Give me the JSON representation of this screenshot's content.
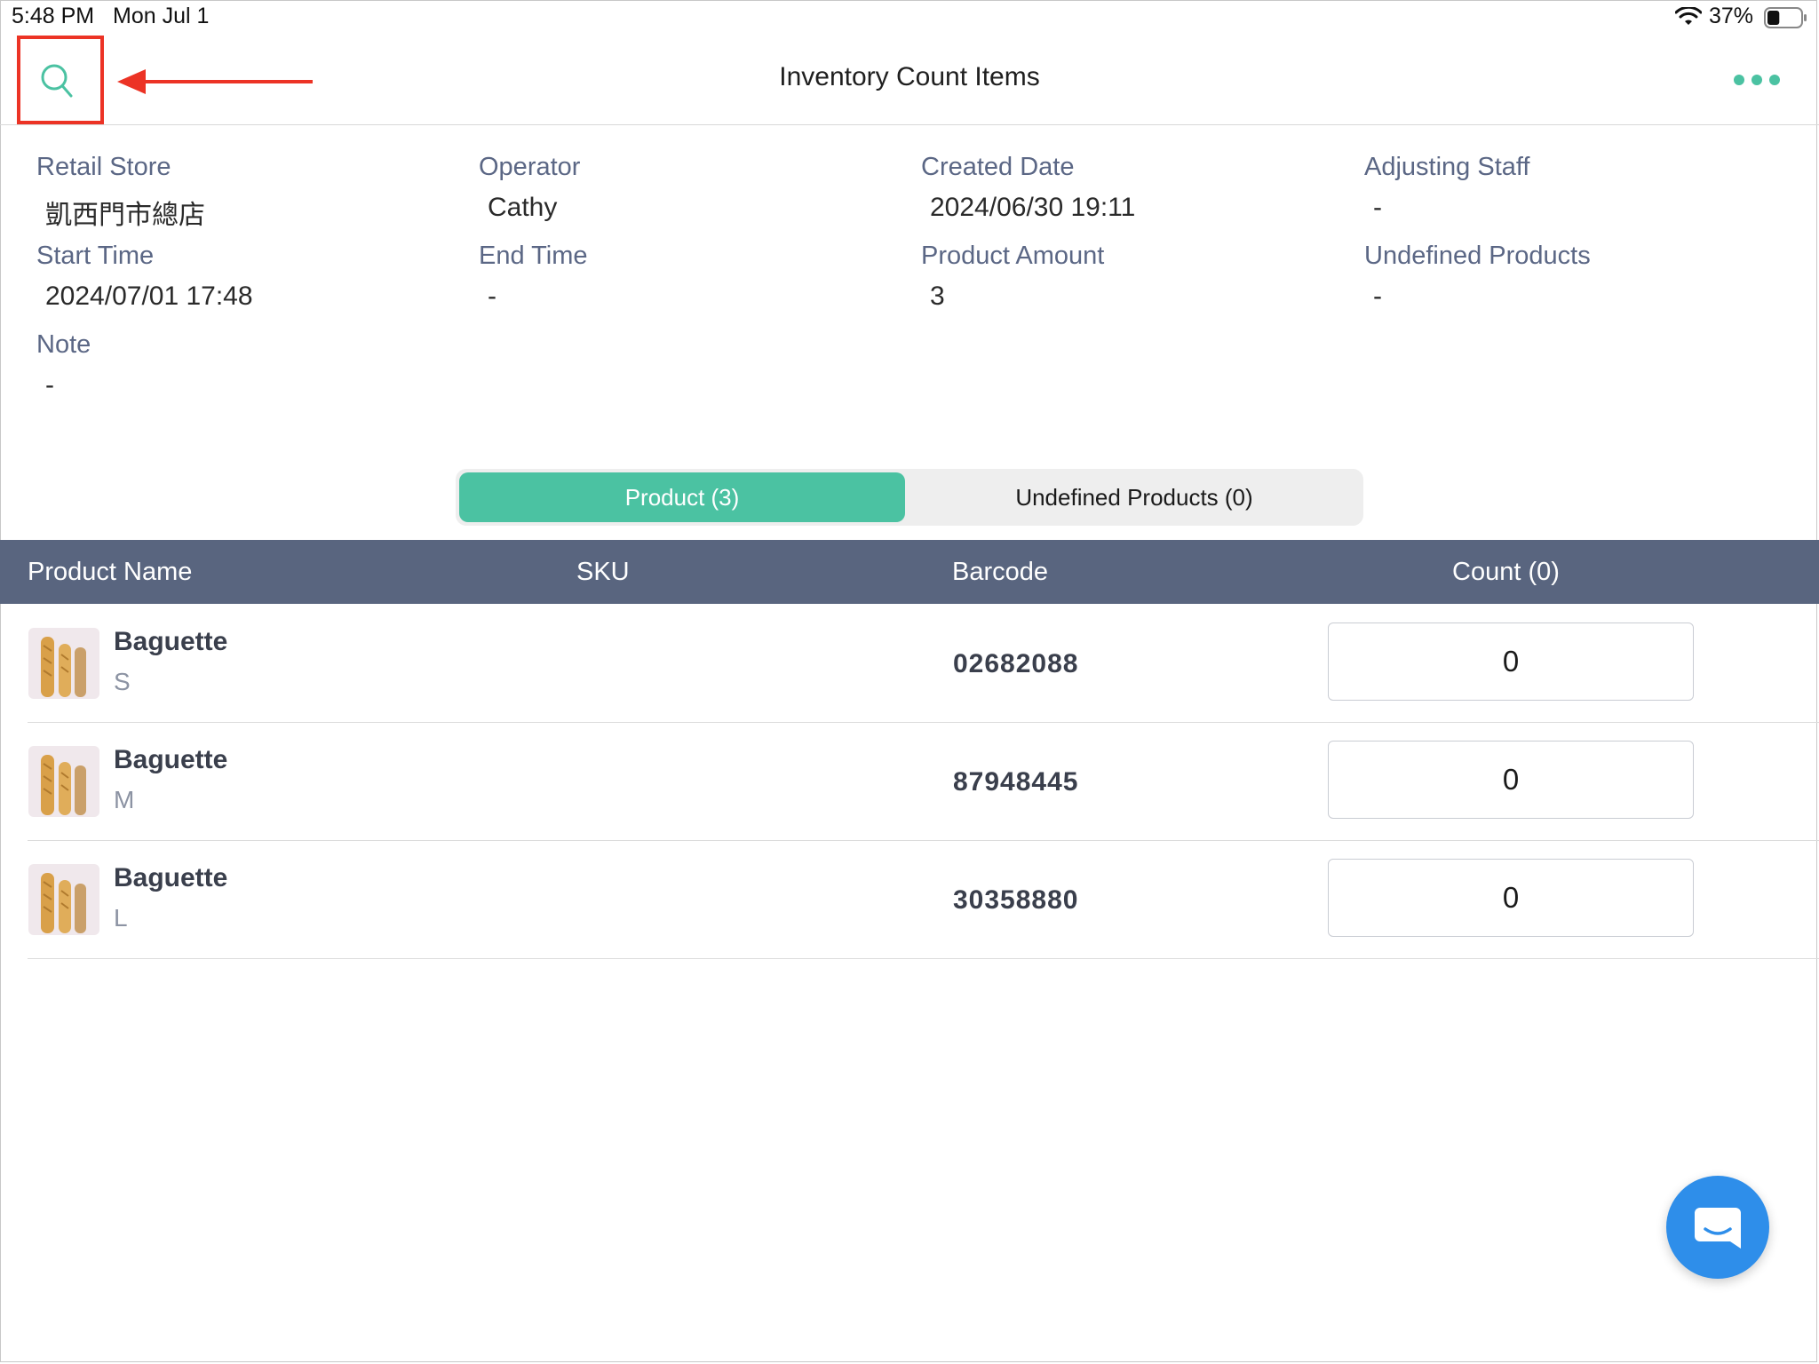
{
  "status_bar": {
    "time": "5:48 PM",
    "date": "Mon Jul 1",
    "battery": "37%",
    "battery_level": 0.37
  },
  "nav": {
    "title": "Inventory Count Items",
    "search_icon": "search-icon",
    "more_icon": "more-dots-icon"
  },
  "info": {
    "retail_store": {
      "label": "Retail Store",
      "value": "凱西門市總店"
    },
    "operator": {
      "label": "Operator",
      "value": "Cathy"
    },
    "created_date": {
      "label": "Created Date",
      "value": "2024/06/30 19:11"
    },
    "adjusting_staff": {
      "label": "Adjusting Staff",
      "value": "-"
    },
    "start_time": {
      "label": "Start Time",
      "value": "2024/07/01 17:48"
    },
    "end_time": {
      "label": "End Time",
      "value": "-"
    },
    "product_amount": {
      "label": "Product Amount",
      "value": "3"
    },
    "undefined_products": {
      "label": "Undefined Products",
      "value": "-"
    },
    "note": {
      "label": "Note",
      "value": "-"
    }
  },
  "tabs": [
    {
      "label": "Product (3)",
      "active": true
    },
    {
      "label": "Undefined Products (0)",
      "active": false
    }
  ],
  "table": {
    "headers": {
      "product_name": "Product Name",
      "sku": "SKU",
      "barcode": "Barcode",
      "count": "Count (0)"
    },
    "rows": [
      {
        "name": "Baguette",
        "variant": "S",
        "sku": "",
        "barcode": "02682088",
        "count": "0"
      },
      {
        "name": "Baguette",
        "variant": "M",
        "sku": "",
        "barcode": "87948445",
        "count": "0"
      },
      {
        "name": "Baguette",
        "variant": "L",
        "sku": "",
        "barcode": "30358880",
        "count": "0"
      }
    ]
  },
  "colors": {
    "accent": "#4bc2a2",
    "header": "#59657f",
    "label": "#5b6785",
    "chat": "#2e8eea",
    "annotation": "#ec3325"
  },
  "chat_icon": "chat-bubble-icon"
}
